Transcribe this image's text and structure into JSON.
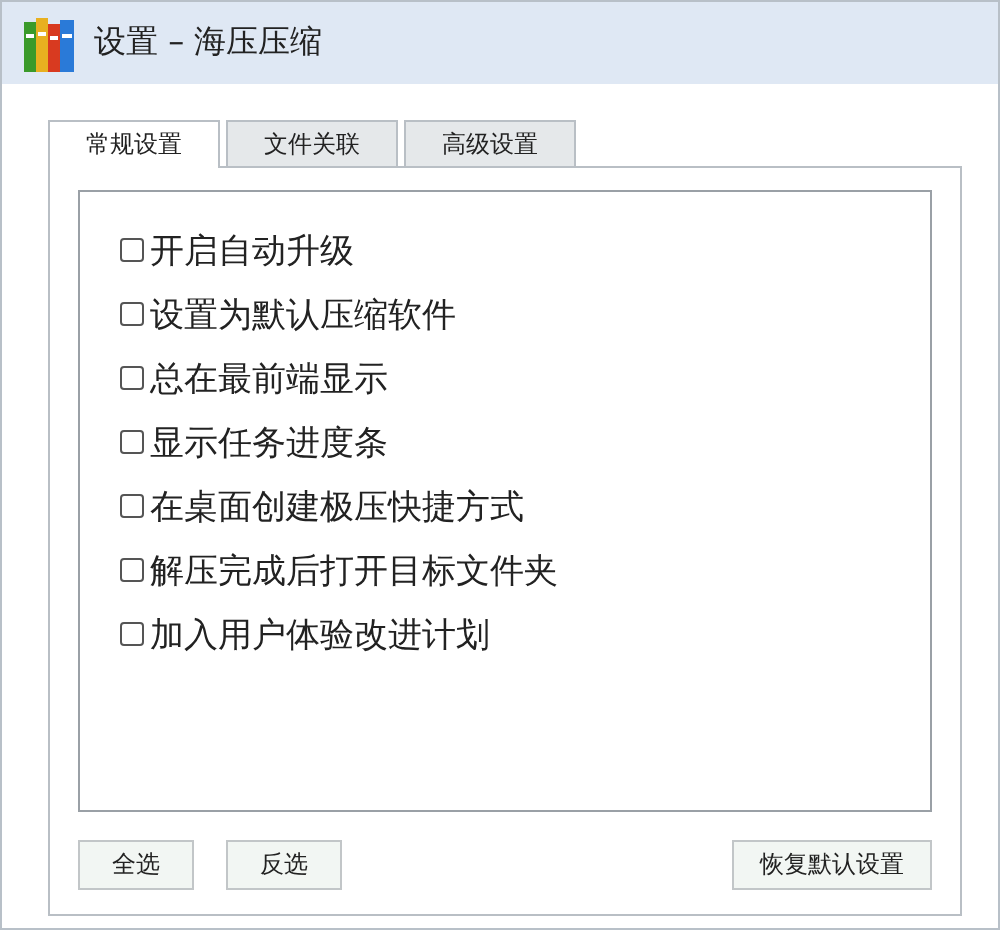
{
  "window": {
    "title": "设置 – 海压压缩"
  },
  "tabs": [
    {
      "label": "常规设置",
      "selected": true
    },
    {
      "label": "文件关联",
      "selected": false
    },
    {
      "label": "高级设置",
      "selected": false
    }
  ],
  "options": [
    {
      "label": "开启自动升级",
      "checked": false
    },
    {
      "label": "设置为默认压缩软件",
      "checked": false
    },
    {
      "label": "总在最前端显示",
      "checked": false
    },
    {
      "label": "显示任务进度条",
      "checked": false
    },
    {
      "label": "在桌面创建极压快捷方式",
      "checked": false
    },
    {
      "label": "解压完成后打开目标文件夹",
      "checked": false
    },
    {
      "label": "加入用户体验改进计划",
      "checked": false
    }
  ],
  "buttons": [
    {
      "label": "全选",
      "kind": "left"
    },
    {
      "label": "反选",
      "kind": "left"
    },
    {
      "label": "恢复默认设置",
      "kind": "right"
    }
  ]
}
